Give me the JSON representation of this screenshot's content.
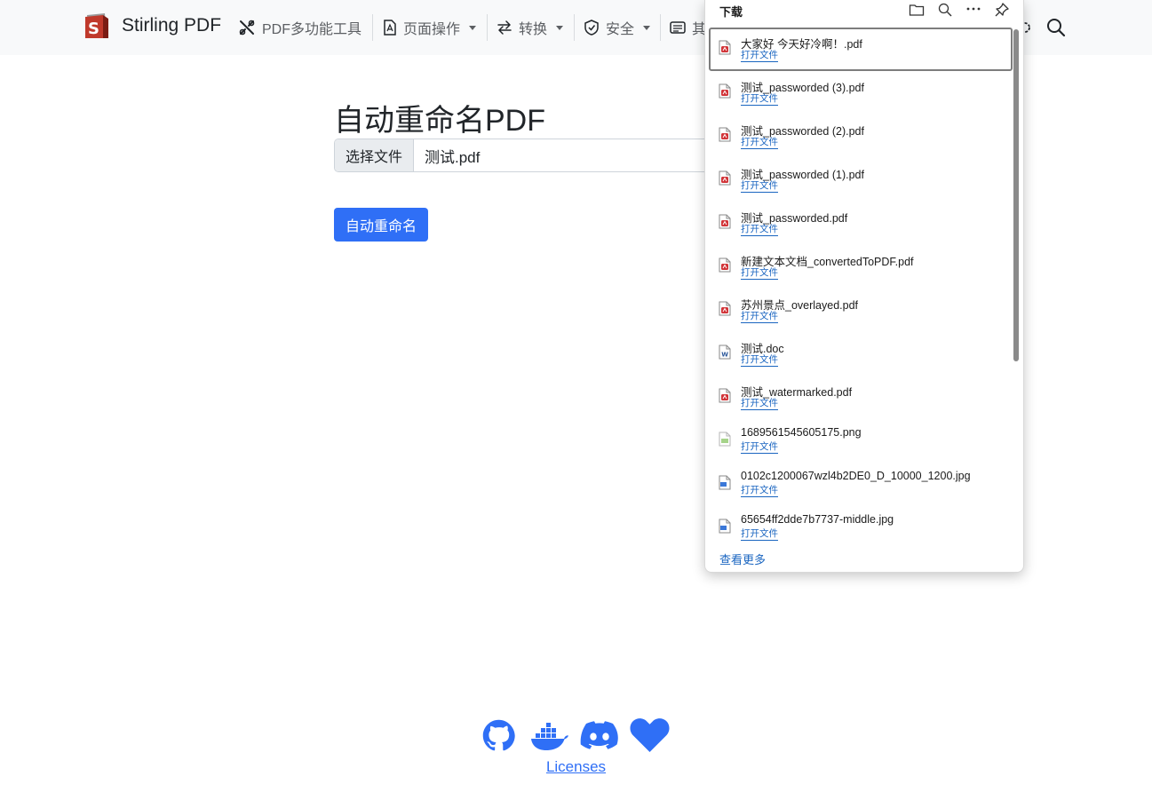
{
  "navbar": {
    "brand": "Stirling PDF",
    "items": [
      {
        "label": "PDF多功能工具",
        "icon": "tools-icon",
        "dropdown": false
      },
      {
        "label": "页面操作",
        "icon": "file-pdf-icon",
        "dropdown": true
      },
      {
        "label": "转换",
        "icon": "arrows-swap-icon",
        "dropdown": true
      },
      {
        "label": "安全",
        "icon": "shield-icon",
        "dropdown": true
      },
      {
        "label": "其",
        "icon": "list-card-icon",
        "dropdown": false
      }
    ],
    "right_icons": [
      "gear-icon",
      "search-icon"
    ]
  },
  "main": {
    "title": "自动重命名PDF",
    "file_button": "选择文件",
    "file_name": "测试.pdf",
    "submit_label": "自动重命名"
  },
  "footer": {
    "icons": [
      "github-icon",
      "docker-icon",
      "discord-icon",
      "heart-icon"
    ],
    "licenses_label": "Licenses",
    "accent": "#2f6ff6"
  },
  "downloads": {
    "title": "下载",
    "header_icons": [
      "folder-icon",
      "search-icon",
      "more-icon",
      "pin-icon"
    ],
    "open_label": "打开文件",
    "more_label": "查看更多",
    "items": [
      {
        "name": "大家好 今天好冷啊！.pdf",
        "type": "pdf",
        "selected": true
      },
      {
        "name": "测试_passworded (3).pdf",
        "type": "pdf",
        "selected": false
      },
      {
        "name": "测试_passworded (2).pdf",
        "type": "pdf",
        "selected": false
      },
      {
        "name": "测试_passworded (1).pdf",
        "type": "pdf",
        "selected": false
      },
      {
        "name": "测试_passworded.pdf",
        "type": "pdf",
        "selected": false
      },
      {
        "name": "新建文本文档_convertedToPDF.pdf",
        "type": "pdf",
        "selected": false
      },
      {
        "name": "苏州景点_overlayed.pdf",
        "type": "pdf",
        "selected": false
      },
      {
        "name": "测试.doc",
        "type": "doc",
        "selected": false
      },
      {
        "name": "测试_watermarked.pdf",
        "type": "pdf",
        "selected": false
      },
      {
        "name": "1689561545605175.png",
        "type": "png",
        "selected": false
      },
      {
        "name": "0102c1200067wzl4b2DE0_D_10000_1200.jpg",
        "type": "jpg",
        "selected": false
      },
      {
        "name": "65654ff2dde7b7737-middle.jpg",
        "type": "jpg",
        "selected": false
      }
    ]
  }
}
